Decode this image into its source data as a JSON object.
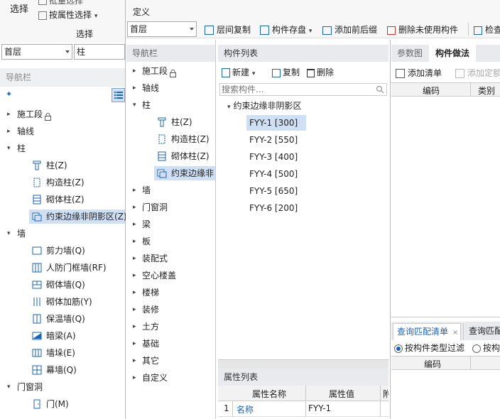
{
  "ribbon": {
    "select_group_label": "选择",
    "select_big_button": "选择",
    "batch_select": "批量选择",
    "attr_select": "按属性选择",
    "define_group_label": "定义"
  },
  "left": {
    "floor_combo": "首层",
    "category_combo": "柱",
    "nav_title": "导航栏",
    "tree": [
      {
        "label": "施工段",
        "type": "group",
        "expanded": false
      },
      {
        "label": "轴线",
        "type": "group",
        "expanded": false
      },
      {
        "label": "柱",
        "type": "group",
        "expanded": true
      },
      {
        "label": "柱(Z)",
        "type": "item",
        "icon": "column-icon"
      },
      {
        "label": "构造柱(Z)",
        "type": "item",
        "icon": "constructional-column-icon"
      },
      {
        "label": "砌体柱(Z)",
        "type": "item",
        "icon": "masonry-column-icon"
      },
      {
        "label": "约束边缘非阴影区(Z)",
        "type": "item",
        "icon": "edge-zone-icon",
        "selected": true
      },
      {
        "label": "墙",
        "type": "group",
        "expanded": true
      },
      {
        "label": "剪力墙(Q)",
        "type": "item",
        "icon": "shear-wall-icon"
      },
      {
        "label": "人防门框墙(RF)",
        "type": "item",
        "icon": "civil-defense-wall-icon"
      },
      {
        "label": "砌体墙(Q)",
        "type": "item",
        "icon": "masonry-wall-icon"
      },
      {
        "label": "砌体加筋(Y)",
        "type": "item",
        "icon": "masonry-rebar-icon"
      },
      {
        "label": "保温墙(Q)",
        "type": "item",
        "icon": "insulation-wall-icon"
      },
      {
        "label": "暗梁(A)",
        "type": "item",
        "icon": "hidden-beam-icon"
      },
      {
        "label": "墙垛(E)",
        "type": "item",
        "icon": "wall-pier-icon"
      },
      {
        "label": "幕墙(Q)",
        "type": "item",
        "icon": "curtain-wall-icon"
      },
      {
        "label": "门窗洞",
        "type": "group",
        "expanded": true
      },
      {
        "label": "门(M)",
        "type": "item",
        "icon": "door-icon"
      }
    ]
  },
  "toolbar": {
    "floor_combo": "首层",
    "floor_copy": "层间复制",
    "component_save": "构件存盘",
    "add_prefix": "添加前后缀",
    "delete_unused": "删除未使用构件",
    "check": "检查"
  },
  "nav2": {
    "title": "导航栏",
    "items": [
      {
        "label": "施工段",
        "type": "group",
        "expanded": false
      },
      {
        "label": "轴线",
        "type": "group",
        "expanded": false
      },
      {
        "label": "柱",
        "type": "group",
        "expanded": true
      },
      {
        "label": "柱(Z)",
        "type": "item",
        "icon": "column-icon"
      },
      {
        "label": "构造柱(Z)",
        "type": "item",
        "icon": "constructional-column-icon"
      },
      {
        "label": "砌体柱(Z)",
        "type": "item",
        "icon": "masonry-column-icon"
      },
      {
        "label": "约束边缘非",
        "type": "item",
        "icon": "edge-zone-icon",
        "selected": true
      },
      {
        "label": "墙",
        "type": "group",
        "expanded": false
      },
      {
        "label": "门窗洞",
        "type": "group",
        "expanded": false
      },
      {
        "label": "梁",
        "type": "group",
        "expanded": false
      },
      {
        "label": "板",
        "type": "group",
        "expanded": false
      },
      {
        "label": "装配式",
        "type": "group",
        "expanded": false
      },
      {
        "label": "空心楼盖",
        "type": "group",
        "expanded": false
      },
      {
        "label": "楼梯",
        "type": "group",
        "expanded": false
      },
      {
        "label": "装修",
        "type": "group",
        "expanded": false
      },
      {
        "label": "土方",
        "type": "group",
        "expanded": false
      },
      {
        "label": "基础",
        "type": "group",
        "expanded": false
      },
      {
        "label": "其它",
        "type": "group",
        "expanded": false
      },
      {
        "label": "自定义",
        "type": "group",
        "expanded": false
      }
    ]
  },
  "component_list": {
    "title": "构件列表",
    "new_label": "新建",
    "copy_label": "复制",
    "delete_label": "删除",
    "search_placeholder": "搜索构件...",
    "group_label": "约束边缘非阴影区",
    "items": [
      "FYY-1 [300]",
      "FYY-2 [550]",
      "FYY-3 [400]",
      "FYY-4 [500]",
      "FYY-5 [650]",
      "FYY-6 [200]"
    ],
    "selected_index": 0
  },
  "properties": {
    "title": "属性列表",
    "col_name": "属性名称",
    "col_value": "属性值",
    "col_extra": "附",
    "rows": [
      {
        "num": "1",
        "name": "名称",
        "value": "FYY-1"
      }
    ]
  },
  "right": {
    "tab_params": "参数图",
    "tab_method": "构件做法",
    "add_list": "添加清单",
    "add_quota": "添加定额",
    "col_code": "编码",
    "col_category": "类别",
    "bottom_tab1": "查询匹配清单",
    "bottom_tab2": "查询匹配",
    "radio1": "按构件类型过滤",
    "radio2": "按构",
    "bottom_col_code": "编码"
  },
  "colors": {
    "accent": "#1a64b8",
    "selection": "#cfe0f4",
    "panel_header": "#e9eaed",
    "link": "#1a64b8"
  }
}
